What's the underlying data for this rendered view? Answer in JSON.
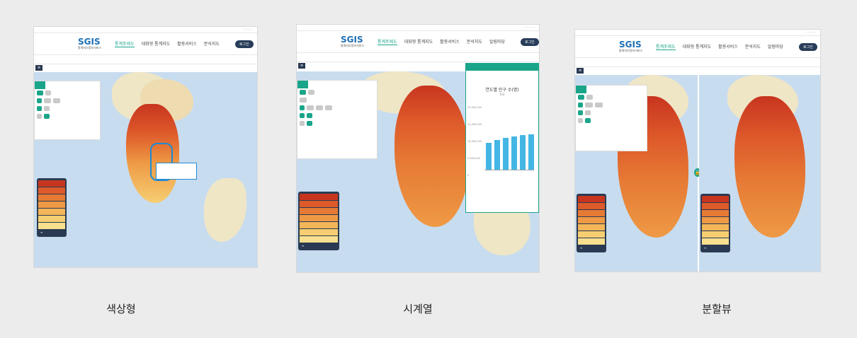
{
  "captions": {
    "color_type": "색상형",
    "time_series": "시계열",
    "split_view": "분할뷰"
  },
  "screens": {
    "logo_text": "SGIS",
    "logo_sub": "통계지리정보서비스",
    "nav_items": [
      "통계주제도",
      "대화형 통계지도",
      "활용서비스",
      "분석지도",
      "알림마당"
    ],
    "login_label": "로그인",
    "time_series_chart": {
      "title": "연도별 인구 수(명)",
      "subtitle": "전국",
      "y_ticks": [
        "20,000,000",
        "15,000,000",
        "10,000,000",
        "5,000,000",
        "0"
      ]
    }
  },
  "colors": {
    "accent": "#1aa58a",
    "navy": "#2a3a52",
    "sea": "#c8dcef",
    "land": "#efe6c6",
    "legend": [
      "#c8351f",
      "#de5a2a",
      "#e67a35",
      "#ee9a45",
      "#f3b658",
      "#f6ce72",
      "#f8e08f"
    ]
  }
}
